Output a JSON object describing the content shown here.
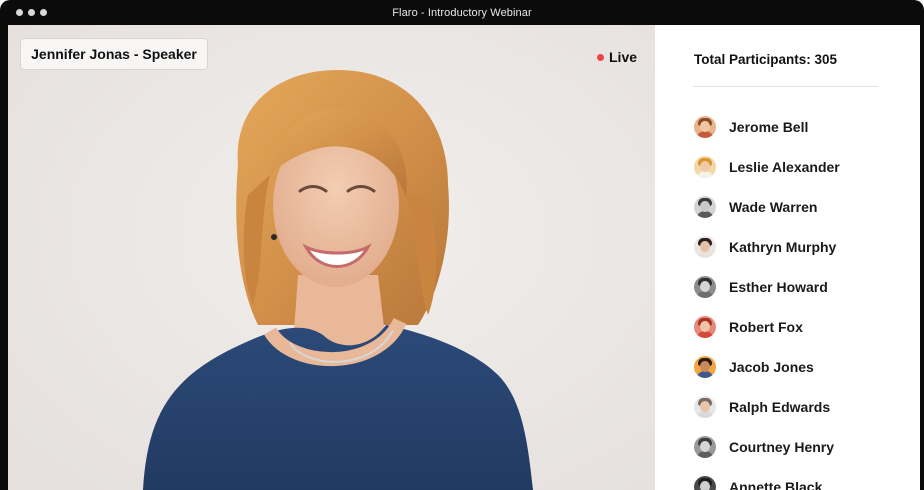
{
  "window": {
    "title": "Flaro - Introductory Webinar"
  },
  "stage": {
    "speaker_label": "Jennifer Jonas - Speaker",
    "live_label": "Live",
    "live_color": "#ef4444"
  },
  "sidebar": {
    "participants_title": "Total Participants: 305",
    "participants": [
      {
        "name": "Jerome Bell",
        "avatar": {
          "bg": "#e9b48d",
          "skin": "#f1c7a3",
          "hair": "#8a4b2a",
          "shirt": "#c75a3a"
        }
      },
      {
        "name": "Leslie Alexander",
        "avatar": {
          "bg": "#f3d7a6",
          "skin": "#f2c9a8",
          "hair": "#d9942f",
          "shirt": "#f5f0e8"
        }
      },
      {
        "name": "Wade Warren",
        "avatar": {
          "bg": "#d3d3d3",
          "skin": "#c9c9c9",
          "hair": "#3a3a3a",
          "shirt": "#5b5b5b"
        }
      },
      {
        "name": "Kathryn Murphy",
        "avatar": {
          "bg": "#ebe6e3",
          "skin": "#e5c1a8",
          "hair": "#2b1f1a",
          "shirt": "#e8e2dc"
        }
      },
      {
        "name": "Esther Howard",
        "avatar": {
          "bg": "#8d8d8d",
          "skin": "#d5d5d5",
          "hair": "#2f2f2f",
          "shirt": "#6f6f6f"
        }
      },
      {
        "name": "Robert Fox",
        "avatar": {
          "bg": "#e58a7b",
          "skin": "#f0c4a6",
          "hair": "#a43325",
          "shirt": "#d44b3a"
        }
      },
      {
        "name": "Jacob Jones",
        "avatar": {
          "bg": "#f2a541",
          "skin": "#c78a5e",
          "hair": "#2b1a10",
          "shirt": "#3d5a8a"
        }
      },
      {
        "name": "Ralph Edwards",
        "avatar": {
          "bg": "#e7e7e7",
          "skin": "#e8c4aa",
          "hair": "#7a6a60",
          "shirt": "#d9d9d9"
        }
      },
      {
        "name": "Courtney Henry",
        "avatar": {
          "bg": "#9a9a9a",
          "skin": "#d6d6d6",
          "hair": "#3c3c3c",
          "shirt": "#5f5f5f"
        }
      },
      {
        "name": "Annette Black",
        "avatar": {
          "bg": "#4a4a4a",
          "skin": "#cfcfcf",
          "hair": "#1f1f1f",
          "shirt": "#6a6a6a"
        }
      }
    ]
  }
}
